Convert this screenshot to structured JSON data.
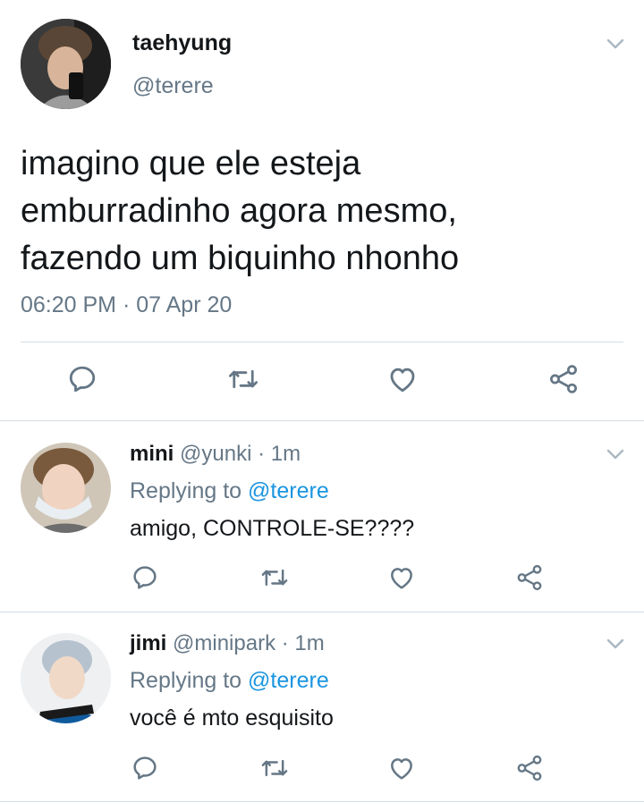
{
  "main_tweet": {
    "display_name": "taehyung",
    "handle": "@terere",
    "text_lines": [
      "imagino que ele esteja",
      "emburradinho agora mesmo,",
      "fazendo um biquinho nhonho"
    ],
    "time": "06:20 PM",
    "date": "07 Apr 20",
    "separator": "·"
  },
  "replies": [
    {
      "display_name": "mini",
      "handle": "@yunki",
      "time": "· 1m",
      "replying_prefix": "Replying to",
      "replying_to": "@terere",
      "text": "amigo, CONTROLE-SE????"
    },
    {
      "display_name": "jimi",
      "handle": "@minipark",
      "time": "· 1m",
      "replying_prefix": "Replying to",
      "replying_to": "@terere",
      "text": "você é mto esquisito"
    }
  ],
  "actions": [
    "reply-icon",
    "retweet-icon",
    "like-icon",
    "share-icon"
  ],
  "colors": {
    "text": "#14171a",
    "secondary": "#657786",
    "link": "#1b95e0",
    "divider": "#d6dde3",
    "icon": "#657786"
  }
}
